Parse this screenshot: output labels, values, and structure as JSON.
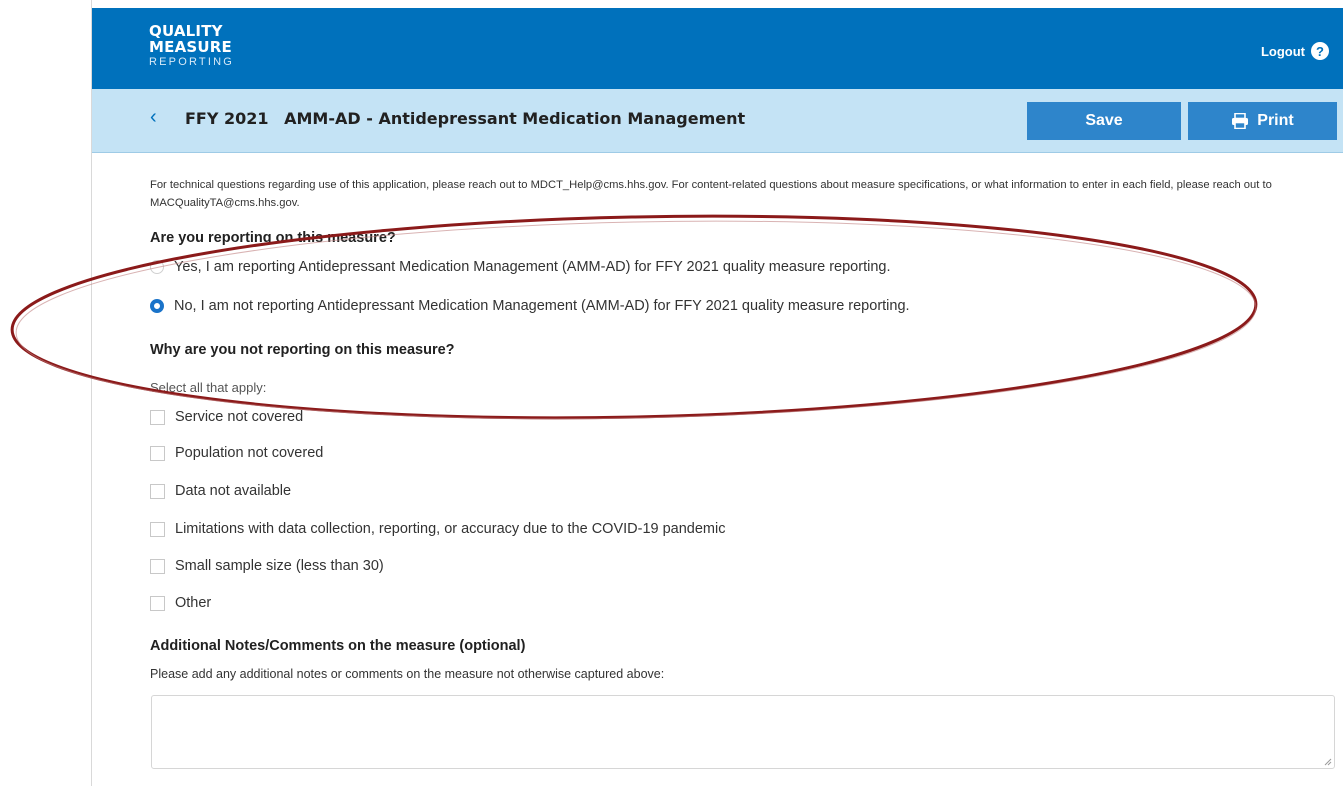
{
  "header": {
    "logo": {
      "line1": "QUALITY",
      "line2": "MEASURE",
      "line3": "REPORTING"
    },
    "logout_label": "Logout",
    "help_icon_glyph": "?"
  },
  "subbar": {
    "back_glyph": "‹",
    "ffy": "FFY 2021",
    "measure_title": "AMM-AD - Antidepressant Medication Management",
    "save_label": "Save",
    "print_label": "Print"
  },
  "intro_text": "For technical questions regarding use of this application, please reach out to MDCT_Help@cms.hhs.gov. For content-related questions about measure specifications, or what information to enter in each field, please reach out to MACQualityTA@cms.hhs.gov.",
  "reporting": {
    "question": "Are you reporting on this measure?",
    "options": [
      {
        "label": "Yes, I am reporting Antidepressant Medication Management (AMM-AD) for FFY 2021 quality measure reporting.",
        "selected": false
      },
      {
        "label": "No, I am not reporting Antidepressant Medication Management (AMM-AD) for FFY 2021 quality measure reporting.",
        "selected": true
      }
    ]
  },
  "why_not": {
    "question": "Why are you not reporting on this measure?",
    "hint": "Select all that apply:",
    "options": [
      {
        "label": "Service not covered",
        "checked": false
      },
      {
        "label": "Population not covered",
        "checked": false
      },
      {
        "label": "Data not available",
        "checked": false
      },
      {
        "label": "Limitations with data collection, reporting, or accuracy due to the COVID-19 pandemic",
        "checked": false
      },
      {
        "label": "Small sample size (less than 30)",
        "checked": false
      },
      {
        "label": "Other",
        "checked": false
      }
    ]
  },
  "notes": {
    "heading": "Additional Notes/Comments on the measure (optional)",
    "hint": "Please add any additional notes or comments on the measure not otherwise captured above:",
    "value": ""
  },
  "colors": {
    "header_blue": "#0071bc",
    "subbar_light_blue": "#c4e3f5",
    "button_blue": "#2e85cb",
    "annotation_red": "#8b1a1a"
  },
  "icons": [
    "help-icon",
    "back-chevron-icon",
    "printer-icon",
    "resize-grip-icon"
  ]
}
